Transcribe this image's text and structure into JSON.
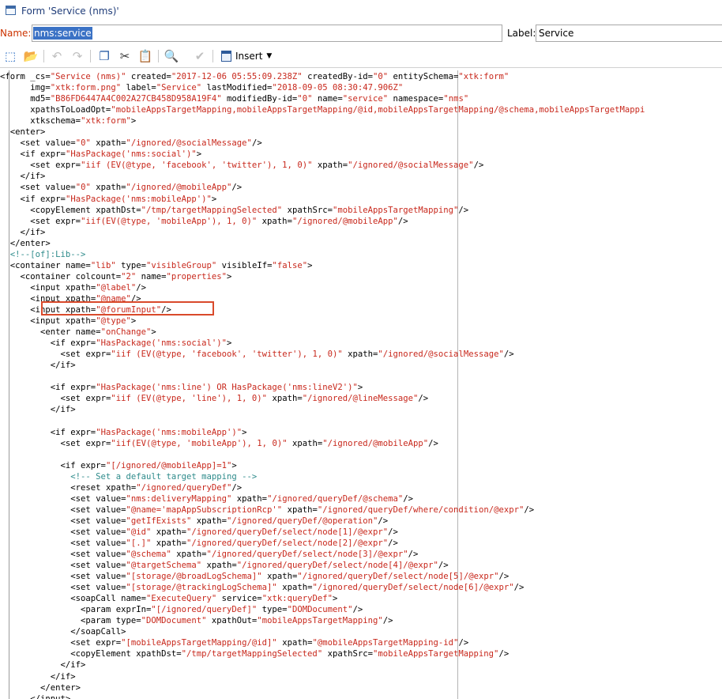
{
  "window": {
    "title": "Form 'Service (nms)'"
  },
  "name_field": {
    "label": "Name:",
    "value": "nms:service"
  },
  "label_field": {
    "label": "Label:",
    "value": "Service"
  },
  "toolbar": {
    "insert_label": "Insert",
    "icons": [
      "new-document-icon",
      "open-folder-icon",
      "undo-icon",
      "redo-icon",
      "copy-icon",
      "cut-icon",
      "paste-icon",
      "find-icon",
      "validate-icon",
      "insert-icon",
      "dropdown-arrow-icon"
    ]
  },
  "colors": {
    "tag": "#000000",
    "value": "#c8281c",
    "comment": "#2e8b8b",
    "highlight": "#d94a2b",
    "selection": "#3b72c5"
  },
  "highlight_line": 21,
  "code_lines": [
    [
      [
        "t",
        "<form _cs="
      ],
      [
        "v",
        "\"Service (nms)\""
      ],
      [
        "a",
        " created="
      ],
      [
        "v",
        "\"2017-12-06 05:55:09.238Z\""
      ],
      [
        "a",
        " createdBy-id="
      ],
      [
        "v",
        "\"0\""
      ],
      [
        "a",
        " entitySchema="
      ],
      [
        "v",
        "\"xtk:form\""
      ]
    ],
    [
      [
        "a",
        "      img="
      ],
      [
        "v",
        "\"xtk:form.png\""
      ],
      [
        "a",
        " label="
      ],
      [
        "v",
        "\"Service\""
      ],
      [
        "a",
        " lastModified="
      ],
      [
        "v",
        "\"2018-09-05 08:30:47.906Z\""
      ]
    ],
    [
      [
        "a",
        "      md5="
      ],
      [
        "v",
        "\"B86FD6447A4C002A27CB458D958A19F4\""
      ],
      [
        "a",
        " modifiedBy-id="
      ],
      [
        "v",
        "\"0\""
      ],
      [
        "a",
        " name="
      ],
      [
        "v",
        "\"service\""
      ],
      [
        "a",
        " namespace="
      ],
      [
        "v",
        "\"nms\""
      ]
    ],
    [
      [
        "a",
        "      xpathsToLoadOpt="
      ],
      [
        "v",
        "\"mobileAppsTargetMapping,mobileAppsTargetMapping/@id,mobileAppsTargetMapping/@schema,mobileAppsTargetMappi"
      ]
    ],
    [
      [
        "a",
        "      xtkschema="
      ],
      [
        "v",
        "\"xtk:form\""
      ],
      [
        "t",
        ">"
      ]
    ],
    [
      [
        "t",
        "  <enter>"
      ]
    ],
    [
      [
        "t",
        "    <set"
      ],
      [
        "a",
        " value="
      ],
      [
        "v",
        "\"0\""
      ],
      [
        "a",
        " xpath="
      ],
      [
        "v",
        "\"/ignored/@socialMessage\""
      ],
      [
        "t",
        "/>"
      ]
    ],
    [
      [
        "t",
        "    <if"
      ],
      [
        "a",
        " expr="
      ],
      [
        "v",
        "\"HasPackage('nms:social')\""
      ],
      [
        "t",
        ">"
      ]
    ],
    [
      [
        "t",
        "      <set"
      ],
      [
        "a",
        " expr="
      ],
      [
        "v",
        "\"iif (EV(@type, 'facebook', 'twitter'), 1, 0)\""
      ],
      [
        "a",
        " xpath="
      ],
      [
        "v",
        "\"/ignored/@socialMessage\""
      ],
      [
        "t",
        "/>"
      ]
    ],
    [
      [
        "t",
        "    </if>"
      ]
    ],
    [
      [
        "t",
        "    <set"
      ],
      [
        "a",
        " value="
      ],
      [
        "v",
        "\"0\""
      ],
      [
        "a",
        " xpath="
      ],
      [
        "v",
        "\"/ignored/@mobileApp\""
      ],
      [
        "t",
        "/>"
      ]
    ],
    [
      [
        "t",
        "    <if"
      ],
      [
        "a",
        " expr="
      ],
      [
        "v",
        "\"HasPackage('nms:mobileApp')\""
      ],
      [
        "t",
        ">"
      ]
    ],
    [
      [
        "t",
        "      <copyElement"
      ],
      [
        "a",
        " xpathDst="
      ],
      [
        "v",
        "\"/tmp/targetMappingSelected\""
      ],
      [
        "a",
        " xpathSrc="
      ],
      [
        "v",
        "\"mobileAppsTargetMapping\""
      ],
      [
        "t",
        "/>"
      ]
    ],
    [
      [
        "t",
        "      <set"
      ],
      [
        "a",
        " expr="
      ],
      [
        "v",
        "\"iif(EV(@type, 'mobileApp'), 1, 0)\""
      ],
      [
        "a",
        " xpath="
      ],
      [
        "v",
        "\"/ignored/@mobileApp\""
      ],
      [
        "t",
        "/>"
      ]
    ],
    [
      [
        "t",
        "    </if>"
      ]
    ],
    [
      [
        "t",
        "  </enter>"
      ]
    ],
    [
      [
        "c",
        "  <!--[of]:Lib-->"
      ]
    ],
    [
      [
        "t",
        "  <container"
      ],
      [
        "a",
        " name="
      ],
      [
        "v",
        "\"lib\""
      ],
      [
        "a",
        " type="
      ],
      [
        "v",
        "\"visibleGroup\""
      ],
      [
        "a",
        " visibleIf="
      ],
      [
        "v",
        "\"false\""
      ],
      [
        "t",
        ">"
      ]
    ],
    [
      [
        "t",
        "    <container"
      ],
      [
        "a",
        " colcount="
      ],
      [
        "v",
        "\"2\""
      ],
      [
        "a",
        " name="
      ],
      [
        "v",
        "\"properties\""
      ],
      [
        "t",
        ">"
      ]
    ],
    [
      [
        "t",
        "      <input"
      ],
      [
        "a",
        " xpath="
      ],
      [
        "v",
        "\"@label\""
      ],
      [
        "t",
        "/>"
      ]
    ],
    [
      [
        "t",
        "      <input"
      ],
      [
        "a",
        " xpath="
      ],
      [
        "v",
        "\"@name\""
      ],
      [
        "t",
        "/>"
      ]
    ],
    [
      [
        "t",
        "      <input"
      ],
      [
        "a",
        " xpath="
      ],
      [
        "v",
        "\"@forumInput\""
      ],
      [
        "t",
        "/>"
      ]
    ],
    [
      [
        "t",
        "      <input"
      ],
      [
        "a",
        " xpath="
      ],
      [
        "v",
        "\"@type\""
      ],
      [
        "t",
        ">"
      ]
    ],
    [
      [
        "t",
        "        <enter"
      ],
      [
        "a",
        " name="
      ],
      [
        "v",
        "\"onChange\""
      ],
      [
        "t",
        ">"
      ]
    ],
    [
      [
        "t",
        "          <if"
      ],
      [
        "a",
        " expr="
      ],
      [
        "v",
        "\"HasPackage('nms:social')\""
      ],
      [
        "t",
        ">"
      ]
    ],
    [
      [
        "t",
        "            <set"
      ],
      [
        "a",
        " expr="
      ],
      [
        "v",
        "\"iif (EV(@type, 'facebook', 'twitter'), 1, 0)\""
      ],
      [
        "a",
        " xpath="
      ],
      [
        "v",
        "\"/ignored/@socialMessage\""
      ],
      [
        "t",
        "/>"
      ]
    ],
    [
      [
        "t",
        "          </if>"
      ]
    ],
    [
      [
        "t",
        ""
      ]
    ],
    [
      [
        "t",
        "          <if"
      ],
      [
        "a",
        " expr="
      ],
      [
        "v",
        "\"HasPackage('nms:line') OR HasPackage('nms:lineV2')\""
      ],
      [
        "t",
        ">"
      ]
    ],
    [
      [
        "t",
        "            <set"
      ],
      [
        "a",
        " expr="
      ],
      [
        "v",
        "\"iif (EV(@type, 'line'), 1, 0)\""
      ],
      [
        "a",
        " xpath="
      ],
      [
        "v",
        "\"/ignored/@lineMessage\""
      ],
      [
        "t",
        "/>"
      ]
    ],
    [
      [
        "t",
        "          </if>"
      ]
    ],
    [
      [
        "t",
        ""
      ]
    ],
    [
      [
        "t",
        "          <if"
      ],
      [
        "a",
        " expr="
      ],
      [
        "v",
        "\"HasPackage('nms:mobileApp')\""
      ],
      [
        "t",
        ">"
      ]
    ],
    [
      [
        "t",
        "            <set"
      ],
      [
        "a",
        " expr="
      ],
      [
        "v",
        "\"iif(EV(@type, 'mobileApp'), 1, 0)\""
      ],
      [
        "a",
        " xpath="
      ],
      [
        "v",
        "\"/ignored/@mobileApp\""
      ],
      [
        "t",
        "/>"
      ]
    ],
    [
      [
        "t",
        ""
      ]
    ],
    [
      [
        "t",
        "            <if"
      ],
      [
        "a",
        " expr="
      ],
      [
        "v",
        "\"[/ignored/@mobileApp]=1\""
      ],
      [
        "t",
        ">"
      ]
    ],
    [
      [
        "c",
        "              <!-- Set a default target mapping -->"
      ]
    ],
    [
      [
        "t",
        "              <reset"
      ],
      [
        "a",
        " xpath="
      ],
      [
        "v",
        "\"/ignored/queryDef\""
      ],
      [
        "t",
        "/>"
      ]
    ],
    [
      [
        "t",
        "              <set"
      ],
      [
        "a",
        " value="
      ],
      [
        "v",
        "\"nms:deliveryMapping\""
      ],
      [
        "a",
        " xpath="
      ],
      [
        "v",
        "\"/ignored/queryDef/@schema\""
      ],
      [
        "t",
        "/>"
      ]
    ],
    [
      [
        "t",
        "              <set"
      ],
      [
        "a",
        " value="
      ],
      [
        "v",
        "\"@name='mapAppSubscriptionRcp'\""
      ],
      [
        "a",
        " xpath="
      ],
      [
        "v",
        "\"/ignored/queryDef/where/condition/@expr\""
      ],
      [
        "t",
        "/>"
      ]
    ],
    [
      [
        "t",
        "              <set"
      ],
      [
        "a",
        " value="
      ],
      [
        "v",
        "\"getIfExists\""
      ],
      [
        "a",
        " xpath="
      ],
      [
        "v",
        "\"/ignored/queryDef/@operation\""
      ],
      [
        "t",
        "/>"
      ]
    ],
    [
      [
        "t",
        "              <set"
      ],
      [
        "a",
        " value="
      ],
      [
        "v",
        "\"@id\""
      ],
      [
        "a",
        " xpath="
      ],
      [
        "v",
        "\"/ignored/queryDef/select/node[1]/@expr\""
      ],
      [
        "t",
        "/>"
      ]
    ],
    [
      [
        "t",
        "              <set"
      ],
      [
        "a",
        " value="
      ],
      [
        "v",
        "\"[.]\""
      ],
      [
        "a",
        " xpath="
      ],
      [
        "v",
        "\"/ignored/queryDef/select/node[2]/@expr\""
      ],
      [
        "t",
        "/>"
      ]
    ],
    [
      [
        "t",
        "              <set"
      ],
      [
        "a",
        " value="
      ],
      [
        "v",
        "\"@schema\""
      ],
      [
        "a",
        " xpath="
      ],
      [
        "v",
        "\"/ignored/queryDef/select/node[3]/@expr\""
      ],
      [
        "t",
        "/>"
      ]
    ],
    [
      [
        "t",
        "              <set"
      ],
      [
        "a",
        " value="
      ],
      [
        "v",
        "\"@targetSchema\""
      ],
      [
        "a",
        " xpath="
      ],
      [
        "v",
        "\"/ignored/queryDef/select/node[4]/@expr\""
      ],
      [
        "t",
        "/>"
      ]
    ],
    [
      [
        "t",
        "              <set"
      ],
      [
        "a",
        " value="
      ],
      [
        "v",
        "\"[storage/@broadLogSchema]\""
      ],
      [
        "a",
        " xpath="
      ],
      [
        "v",
        "\"/ignored/queryDef/select/node[5]/@expr\""
      ],
      [
        "t",
        "/>"
      ]
    ],
    [
      [
        "t",
        "              <set"
      ],
      [
        "a",
        " value="
      ],
      [
        "v",
        "\"[storage/@trackingLogSchema]\""
      ],
      [
        "a",
        " xpath="
      ],
      [
        "v",
        "\"/ignored/queryDef/select/node[6]/@expr\""
      ],
      [
        "t",
        "/>"
      ]
    ],
    [
      [
        "t",
        "              <soapCall"
      ],
      [
        "a",
        " name="
      ],
      [
        "v",
        "\"ExecuteQuery\""
      ],
      [
        "a",
        " service="
      ],
      [
        "v",
        "\"xtk:queryDef\""
      ],
      [
        "t",
        ">"
      ]
    ],
    [
      [
        "t",
        "                <param"
      ],
      [
        "a",
        " exprIn="
      ],
      [
        "v",
        "\"[/ignored/queryDef]\""
      ],
      [
        "a",
        " type="
      ],
      [
        "v",
        "\"DOMDocument\""
      ],
      [
        "t",
        "/>"
      ]
    ],
    [
      [
        "t",
        "                <param"
      ],
      [
        "a",
        " type="
      ],
      [
        "v",
        "\"DOMDocument\""
      ],
      [
        "a",
        " xpathOut="
      ],
      [
        "v",
        "\"mobileAppsTargetMapping\""
      ],
      [
        "t",
        "/>"
      ]
    ],
    [
      [
        "t",
        "              </soapCall>"
      ]
    ],
    [
      [
        "t",
        "              <set"
      ],
      [
        "a",
        " expr="
      ],
      [
        "v",
        "\"[mobileAppsTargetMapping/@id]\""
      ],
      [
        "a",
        " xpath="
      ],
      [
        "v",
        "\"@mobileAppsTargetMapping-id\""
      ],
      [
        "t",
        "/>"
      ]
    ],
    [
      [
        "t",
        "              <copyElement"
      ],
      [
        "a",
        " xpathDst="
      ],
      [
        "v",
        "\"/tmp/targetMappingSelected\""
      ],
      [
        "a",
        " xpathSrc="
      ],
      [
        "v",
        "\"mobileAppsTargetMapping\""
      ],
      [
        "t",
        "/>"
      ]
    ],
    [
      [
        "t",
        "            </if>"
      ]
    ],
    [
      [
        "t",
        "          </if>"
      ]
    ],
    [
      [
        "t",
        "        </enter>"
      ]
    ],
    [
      [
        "t",
        "      </input>"
      ]
    ]
  ]
}
